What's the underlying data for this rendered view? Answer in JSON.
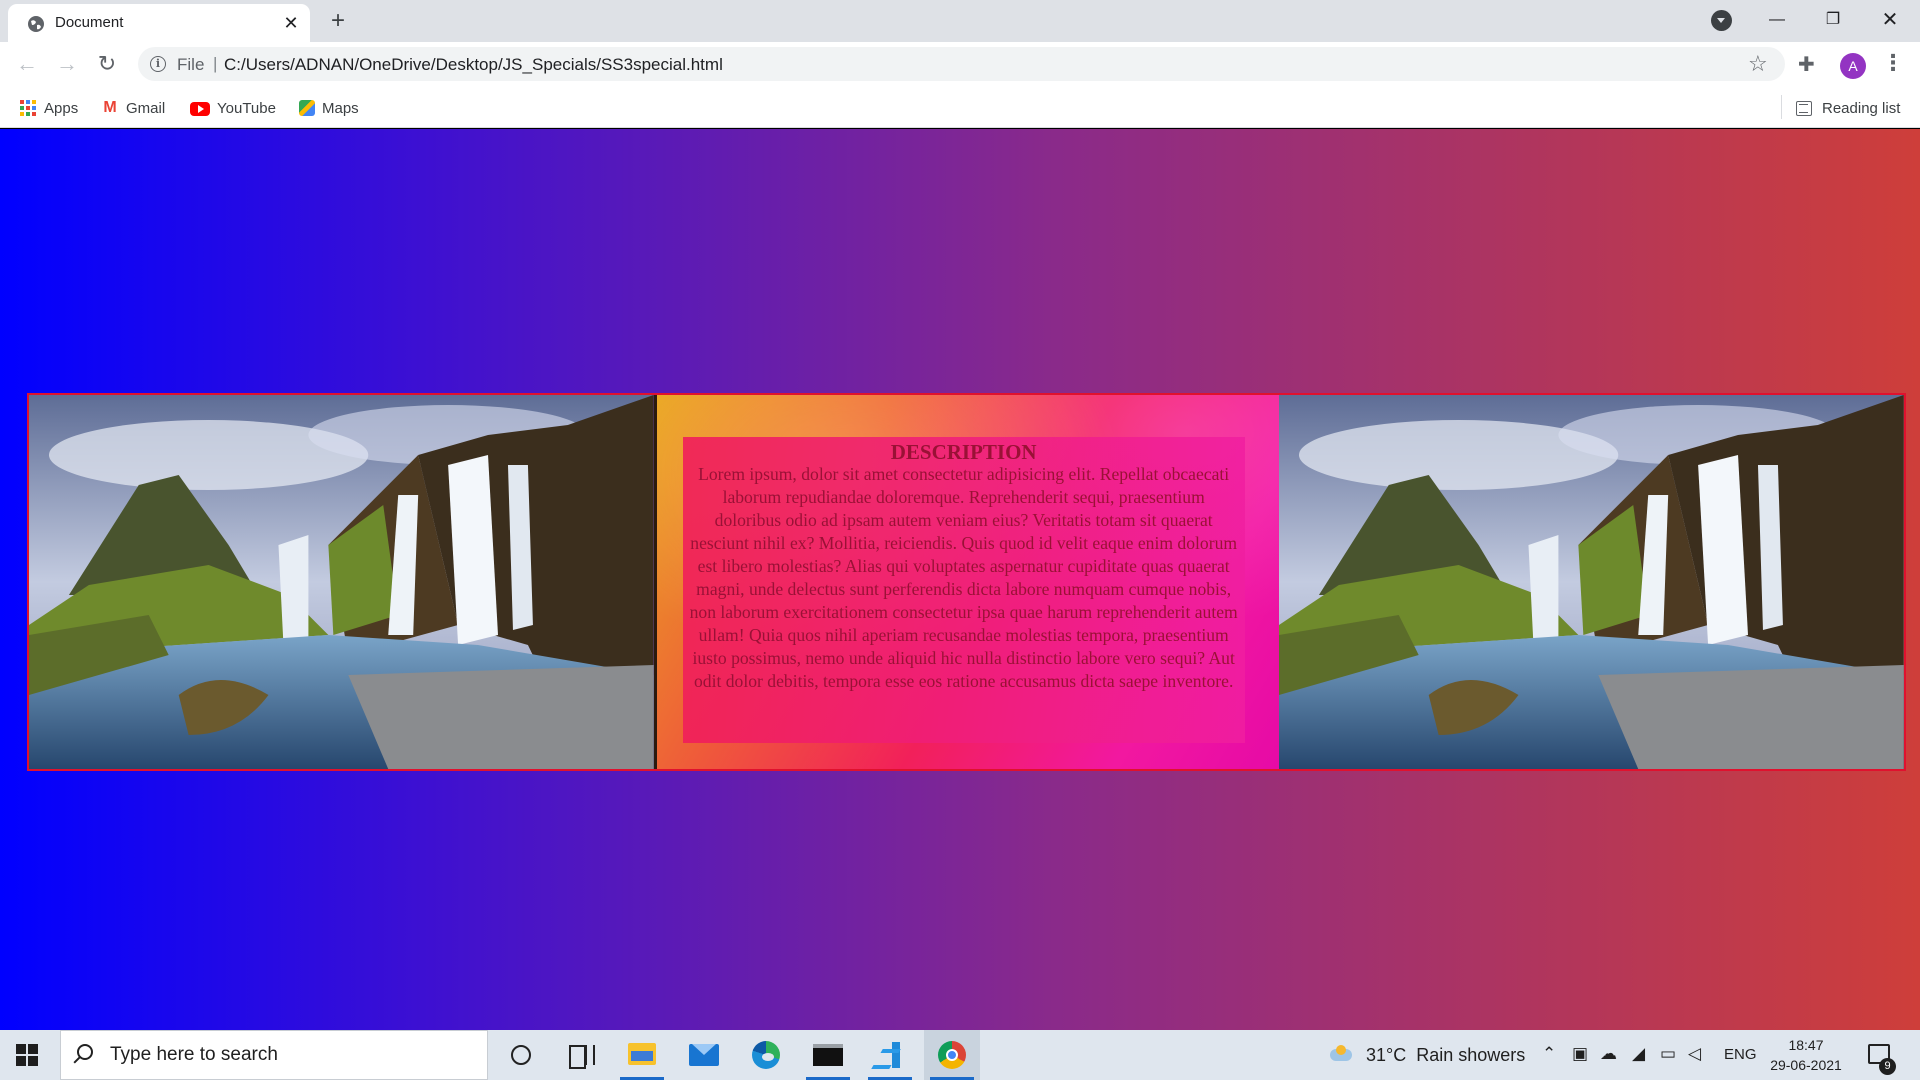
{
  "browser": {
    "tab_title": "Document",
    "url_scheme": "File",
    "url": "C:/Users/ADNAN/OneDrive/Desktop/JS_Specials/SS3special.html",
    "profile_initial": "A",
    "bookmarks": [
      {
        "label": "Apps",
        "icon": "apps-grid-icon"
      },
      {
        "label": "Gmail",
        "icon": "gmail-icon"
      },
      {
        "label": "YouTube",
        "icon": "youtube-icon"
      },
      {
        "label": "Maps",
        "icon": "maps-icon"
      }
    ],
    "reading_list": "Reading list"
  },
  "page": {
    "gradient_colors": [
      "#0000ff",
      "#3d10d2",
      "#8a2a8a",
      "#ce3e3a"
    ],
    "description_title": "DESCRIPTION",
    "description_body": "Lorem ipsum, dolor sit amet consectetur adipisicing elit. Repellat obcaecati laborum repudiandae doloremque. Reprehenderit sequi, praesentium doloribus odio ad ipsam autem veniam eius? Veritatis totam sit quaerat nesciunt nihil ex? Mollitia, reiciendis. Quis quod id velit eaque enim dolorum est libero molestias? Alias qui voluptates aspernatur cupiditate quas quaerat magni, unde delectus sunt perferendis dicta labore numquam cumque nobis, non laborum exercitationem consectetur ipsa quae harum reprehenderit autem ullam! Quia quos nihil aperiam recusandae molestias tempora, praesentium iusto possimus, nemo unde aliquid hic nulla distinctio labore vero sequi? Aut odit dolor debitis, tempora esse eos ratione accusamus dicta saepe inventore."
  },
  "taskbar": {
    "search_placeholder": "Type here to search",
    "weather_temp": "31°C",
    "weather_text": "Rain showers",
    "language": "ENG",
    "time": "18:47",
    "date": "29-06-2021",
    "notification_count": "9"
  }
}
